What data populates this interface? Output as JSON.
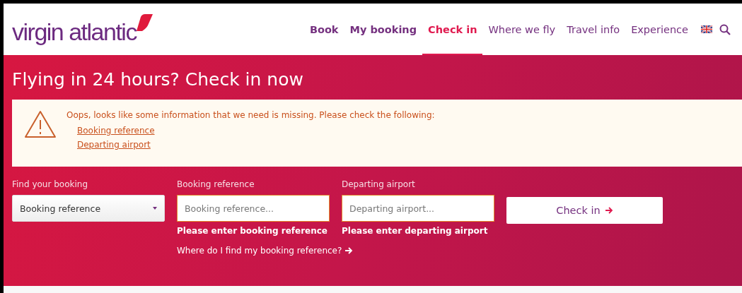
{
  "header": {
    "logo": "virgin atlantic",
    "nav": [
      {
        "label": "Book",
        "kind": "primary",
        "selected": false
      },
      {
        "label": "My booking",
        "kind": "primary",
        "selected": false
      },
      {
        "label": "Check in",
        "kind": "primary",
        "selected": true
      },
      {
        "label": "Where we fly",
        "kind": "secondary",
        "selected": false
      },
      {
        "label": "Travel info",
        "kind": "secondary",
        "selected": false
      },
      {
        "label": "Experience",
        "kind": "secondary",
        "selected": false
      }
    ]
  },
  "hero": {
    "title": "Flying in 24 hours? Check in now",
    "alert": {
      "message": "Oops, looks like some information that we need is missing. Please check the following:",
      "links": [
        "Booking reference",
        "Departing airport"
      ]
    },
    "form": {
      "fields": [
        {
          "kind": "select",
          "label": "Find your booking",
          "value": "Booking reference"
        },
        {
          "kind": "input",
          "label": "Booking reference",
          "placeholder": "Booking reference...",
          "error": "Please enter booking reference",
          "help_link": "Where do I find my booking reference?"
        },
        {
          "kind": "input",
          "label": "Departing airport",
          "placeholder": "Departing airport...",
          "error": "Please enter departing airport"
        }
      ],
      "submit": "Check in"
    }
  }
}
